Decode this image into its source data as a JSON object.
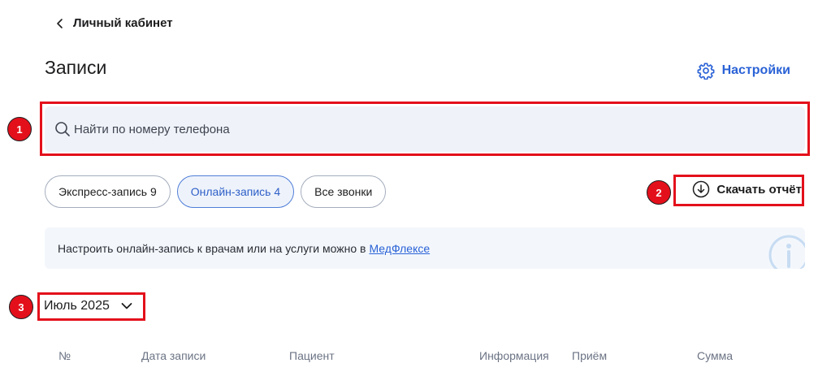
{
  "nav": {
    "back_label": "Личный кабинет"
  },
  "page": {
    "title": "Записи",
    "settings_label": "Настройки"
  },
  "search": {
    "placeholder": "Найти по номеру телефона",
    "value": ""
  },
  "filters": [
    {
      "label": "Экспресс-запись 9",
      "active": false
    },
    {
      "label": "Онлайн-запись 4",
      "active": true
    },
    {
      "label": "Все звонки",
      "active": false
    }
  ],
  "download": {
    "label": "Скачать отчёт"
  },
  "info_banner": {
    "text": "Настроить онлайн-запись к врачам или на услуги можно в",
    "link": "МедФлексе"
  },
  "month_select": {
    "value": "Июль 2025"
  },
  "table": {
    "headers": [
      "№",
      "Дата записи",
      "Пациент",
      "Информация",
      "Приём",
      "Сумма"
    ]
  },
  "annotations": {
    "markers": [
      "1",
      "2",
      "3"
    ],
    "color": "#e3101b"
  },
  "colors": {
    "accent": "#2a62d6",
    "search_bg": "#eff3f9",
    "banner_bg": "#f3f7fc"
  },
  "icons": [
    "chevron-left-icon",
    "gear-icon",
    "search-icon",
    "download-icon",
    "info-icon",
    "chevron-down-icon"
  ]
}
